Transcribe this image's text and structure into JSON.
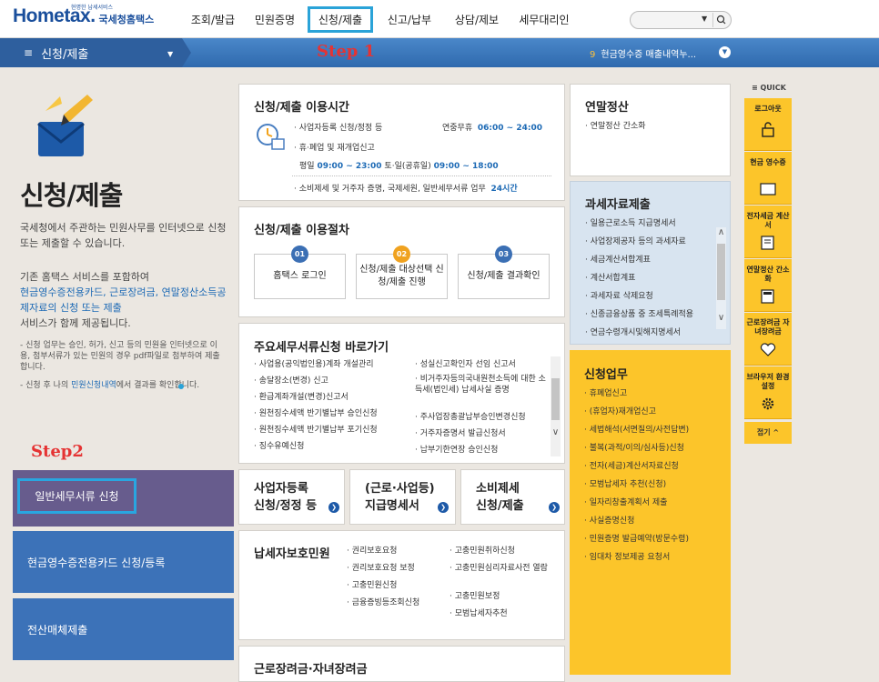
{
  "header": {
    "logo_main": "Hometax.",
    "logo_sub": "국세청홈택스",
    "logo_tiny": "현명한 납세서비스",
    "menu": [
      "조회/발급",
      "민원증명",
      "신청/제출",
      "신고/납부",
      "상담/제보",
      "세무대리인"
    ],
    "search_placeholder": ""
  },
  "navbar": {
    "section": "신청/제출",
    "step1": "Step 1",
    "notice_num": "9",
    "notice_text": "현금영수증 매출내역누..."
  },
  "left": {
    "title": "신청/제출",
    "desc1": "국세청에서 주관하는 민원사무를 인터넷으로 신청 또는 제출할 수 있습니다.",
    "desc2_a": "기존 홈택스 서비스를 포함하여",
    "desc2_hl": "현금영수증전용카드, 근로장려금, 연말정산소득공제자료의 신청 또는 제출",
    "desc2_b": "서비스가 함께 제공됩니다.",
    "bullet1": "- 신청 업무는 승인, 허가, 신고 등의 민원을 인터넷으로 이용, 첨부서류가 있는 민원의 경우 pdf파일로 첨부하여 제출합니다.",
    "bullet2_a": "- 신청 후 나의 ",
    "bullet2_hl": "민원신청내역",
    "bullet2_b": "에서 결과를 확인합니다.",
    "step2": "Step2",
    "box1": "일반세무서류 신청",
    "box2": "현금영수증전용카드 신청/등록",
    "box3": "전산매체제출"
  },
  "hours": {
    "title": "신청/제출 이용시간",
    "r1_label": "· 사업자등록 신청/정정 등",
    "r1_days": "연중무휴",
    "r1_time": "06:00 ~ 24:00",
    "r2_label": "· 휴·폐업 및 재개업신고",
    "r3_a": "평일",
    "r3_t1": "09:00 ~ 23:00",
    "r3_b": "토·일(공휴일)",
    "r3_t2": "09:00 ~ 18:00",
    "r4_label": "· 소비제세 및 거주자 증명, 국제세원, 일반세무서류 업무",
    "r4_time": "24시간"
  },
  "process": {
    "title": "신청/제출 이용절차",
    "steps": [
      {
        "num": "01",
        "label": "홈택스 로그인"
      },
      {
        "num": "02",
        "label": "신청/제출 대상선택 신청/제출 진행"
      },
      {
        "num": "03",
        "label": "신청/제출 결과확인"
      }
    ]
  },
  "shortcuts": {
    "title": "주요세무서류신청 바로가기",
    "col1": [
      "· 사업용(공익법인용)계좌 개설관리",
      "· 송달장소(변경) 신고",
      "· 환급계좌개설(변경)신고서",
      "· 원천징수세액 반기별납부 승인신청",
      "· 원천징수세액 반기별납부 포기신청",
      "· 징수유예신청"
    ],
    "col2": [
      "· 성실신고확인자 선임 신고서",
      "· 비거주자등의국내원천소득에 대한 소득세(법인세) 납세사실 증명",
      "· 주사업장총괄납부승인변경신청",
      "· 거주자증명서 발급신청서",
      "· 납부기한연장 승인신청"
    ]
  },
  "minis": [
    {
      "line1": "사업자등록",
      "line2": "신청/정정 등"
    },
    {
      "line1": "(근로·사업등)",
      "line2": "지급명세서"
    },
    {
      "line1": "소비제세",
      "line2": "신청/제출"
    }
  ],
  "protect": {
    "title": "납세자보호민원",
    "col1": [
      "· 권리보호요청",
      "· 권리보호요청 보정",
      "· 고충민원신청",
      "· 금융증빙등조회신청"
    ],
    "col2": [
      "· 고충민원취하신청",
      "· 고충민원심리자료사전 열람",
      "· 고충민원보정",
      "· 모범납세자추천"
    ]
  },
  "bottom_card_title": "근로장려금·자녀장려금",
  "yearend": {
    "title": "연말정산",
    "item": "· 연말정산 간소화"
  },
  "taxdata": {
    "title": "과세자료제출",
    "items": [
      "· 일용근로소득 지급명세서",
      "· 사업장제공자 등의 과세자료",
      "· 세금계산서합계표",
      "· 계산서합계표",
      "· 과세자료 삭제요청",
      "· 신종금융상품 중 조세특례적용",
      "· 연금수령개시및해지명세서"
    ]
  },
  "apply": {
    "title": "신청업무",
    "items": [
      "· 휴폐업신고",
      "· (휴업자)재개업신고",
      "· 세법해석(서면질의/사전답변)",
      "· 불복(과적/이의/심사등)신청",
      "· 전자(세금)계산서자료신청",
      "· 모범납세자 추천(신청)",
      "· 일자리창출계획서 제출",
      "· 사실증명신청",
      "· 민원증명 발급예약(방문수령)",
      "· 임대차 정보제공 요청서"
    ]
  },
  "quick": {
    "title": "≡ QUICK",
    "items": [
      {
        "label": "로그아웃",
        "icon": "lock-icon"
      },
      {
        "label": "현금 영수증",
        "icon": "receipt-icon"
      },
      {
        "label": "전자세금 계산서",
        "icon": "invoice-icon"
      },
      {
        "label": "연말정산 간소화",
        "icon": "calc-icon"
      },
      {
        "label": "근로장려금 자녀장려금",
        "icon": "heart-icon"
      },
      {
        "label": "브라우저 환경설정",
        "icon": "gear-icon"
      }
    ],
    "close": "접기 ^"
  },
  "colors": {
    "yellow": "#fcc52a",
    "navy": "#2e5f9e",
    "purple": "#675c8d",
    "blue": "#3c72b8",
    "step_red": "#e53333",
    "highlight": "#2aa3d8"
  }
}
